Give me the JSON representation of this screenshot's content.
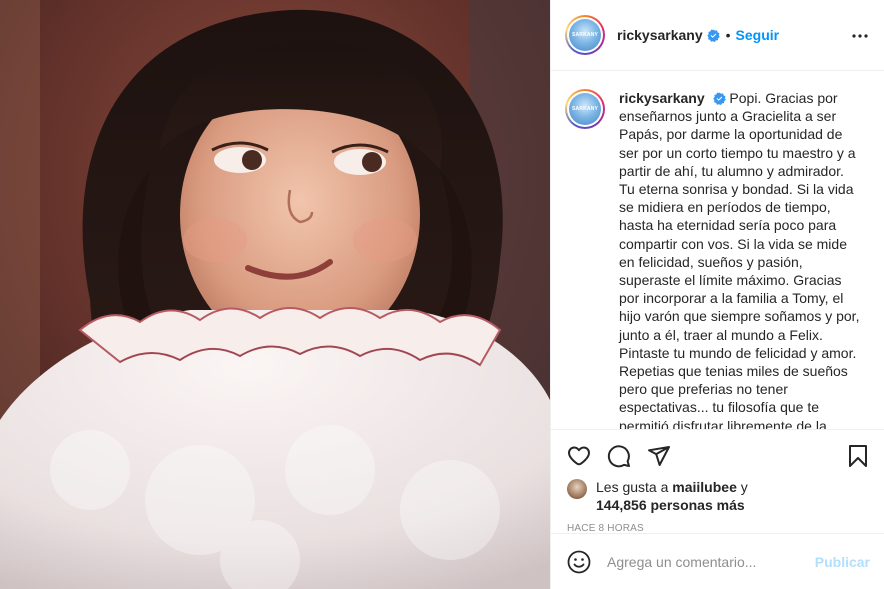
{
  "post": {
    "username": "rickysarkany",
    "follow_label": "Seguir",
    "separator": "•",
    "avatar_text": "SARKANY",
    "caption": "Popi. Gracias por enseñarnos junto a Gracielita a ser Papás, por darme la oportunidad de ser por un corto tiempo tu maestro y a partir de ahí, tu alumno y admirador. Tu eterna sonrisa y bondad. Si la vida se midiera en períodos de tiempo, hasta ha eternidad sería poco para compartir con vos. Si la vida se mide en felicidad, sueños y pasión, superaste el límite máximo. Gracias por incorporar a la familia a Tomy, el hijo varón que siempre soñamos y por, junto a él, traer al mundo a Felix. Pintaste tu mundo de felicidad y amor. Repetias que tenias miles de sueños pero que preferias no tener espectativas... tu filosofía que te permitió disfrutar libremente de la"
  },
  "likes": {
    "prefix": "Les gusta a ",
    "first_user": "maiilubee",
    "connector": " y",
    "count_text": "144,856 personas más"
  },
  "time_ago": "HACE 8 HORAS",
  "comment": {
    "placeholder": "Agrega un comentario...",
    "publish_label": "Publicar"
  },
  "icons": {
    "verified": "verified-badge-icon",
    "more": "more-options-icon",
    "like": "heart-icon",
    "comment": "comment-bubble-icon",
    "share": "paper-plane-icon",
    "save": "bookmark-icon",
    "emoji": "emoji-icon"
  },
  "colors": {
    "accent": "#0095f6",
    "publish_disabled": "#b2dffc",
    "text": "#262626",
    "secondary": "#8e8e8e"
  }
}
